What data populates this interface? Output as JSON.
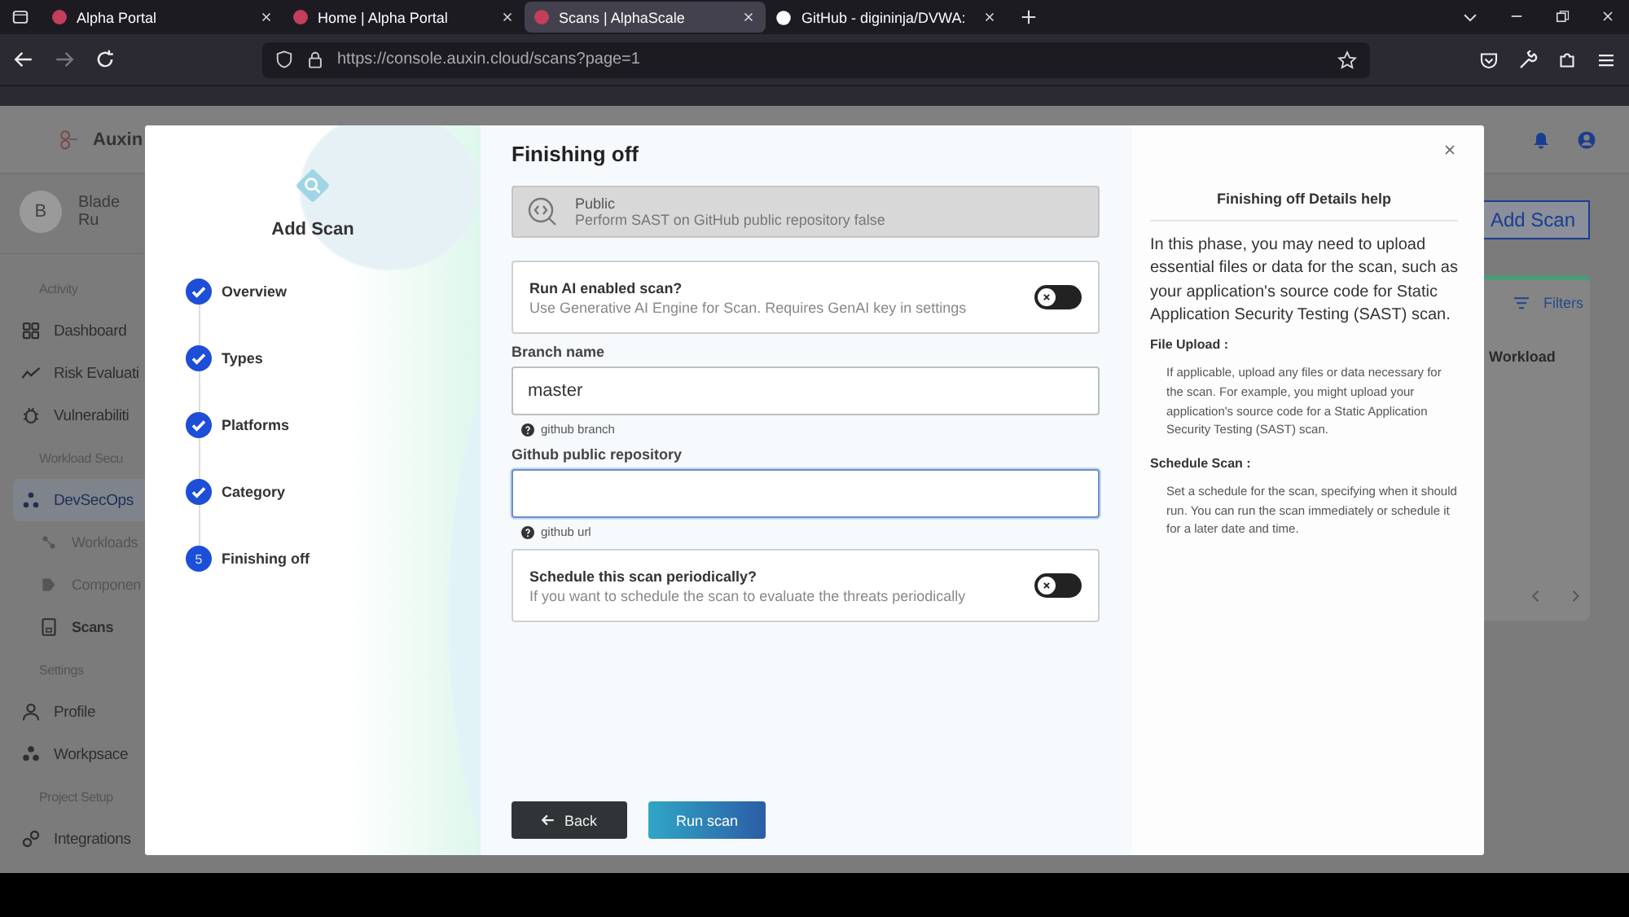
{
  "browser": {
    "tabs": [
      {
        "title": "Alpha Portal",
        "selected": false
      },
      {
        "title": "Home | Alpha Portal",
        "selected": false
      },
      {
        "title": "Scans | AlphaScale",
        "selected": true
      },
      {
        "title": "GitHub - digininja/DVWA:",
        "selected": false
      }
    ],
    "url": "https://console.auxin.cloud/scans?page=1"
  },
  "app": {
    "logo": "Auxin",
    "user": {
      "initial": "B",
      "name": "Blade Ru"
    },
    "sidebar": [
      {
        "kind": "section",
        "label": "Activity"
      },
      {
        "kind": "item",
        "label": "Dashboard",
        "selected": false
      },
      {
        "kind": "item",
        "label": "Risk Evaluati",
        "selected": false
      },
      {
        "kind": "item",
        "label": "Vulnerabiliti",
        "selected": false
      },
      {
        "kind": "section",
        "label": "Workload Secu"
      },
      {
        "kind": "item",
        "label": "DevSecOps",
        "selected": true
      },
      {
        "kind": "subitem",
        "label": "Workloads",
        "selected": false
      },
      {
        "kind": "subitem",
        "label": "Componen",
        "selected": false
      },
      {
        "kind": "subitem",
        "label": "Scans",
        "selected": true
      },
      {
        "kind": "section",
        "label": "Settings"
      },
      {
        "kind": "item",
        "label": "Profile",
        "selected": false
      },
      {
        "kind": "item",
        "label": "Workpsace",
        "selected": false
      },
      {
        "kind": "section",
        "label": "Project Setup"
      },
      {
        "kind": "item",
        "label": "Integrations",
        "selected": false
      }
    ],
    "add_button": "Add Scan",
    "filters": "Filters",
    "column_1": "Workload"
  },
  "modal": {
    "title": "Add Scan",
    "steps": [
      {
        "label": "Overview",
        "completed": true
      },
      {
        "label": "Types",
        "completed": true
      },
      {
        "label": "Platforms",
        "completed": true
      },
      {
        "label": "Category",
        "completed": true
      },
      {
        "label": "Finishing off",
        "completed": false,
        "number": "5"
      }
    ],
    "heading": "Finishing off",
    "scan_type": {
      "title": "Public",
      "description": "Perform SAST on GitHub public repository false"
    },
    "ai_toggle": {
      "title": "Run AI enabled scan?",
      "description": "Use Generative AI Engine for Scan. Requires GenAI key in settings",
      "on": false
    },
    "branch": {
      "label": "Branch name",
      "value": "master",
      "hint": "github branch",
      "focused": false
    },
    "repository": {
      "label": "Github public repository",
      "hint": "github url",
      "focused": true
    },
    "schedule_toggle": {
      "title": "Schedule this scan periodically?",
      "description": "If you want to schedule the scan to evaluate the threats periodically",
      "on": false
    },
    "back_button": "Back",
    "run_button": "Run scan",
    "help": {
      "title": "Finishing off Details help",
      "intro": "In this phase, you may need to upload essential files or data for the scan, such as your application's source code for Static Application Security Testing (SAST) scan.",
      "sections": [
        {
          "heading": "File Upload :",
          "body": "If applicable, upload any files or data necessary for the scan. For example, you might upload your application's source code for a Static Application Security Testing (SAST) scan."
        },
        {
          "heading": "Schedule Scan :",
          "body": "Set a schedule for the scan, specifying when it should run. You can run the scan immediately or schedule it for a later date and time."
        }
      ]
    }
  }
}
